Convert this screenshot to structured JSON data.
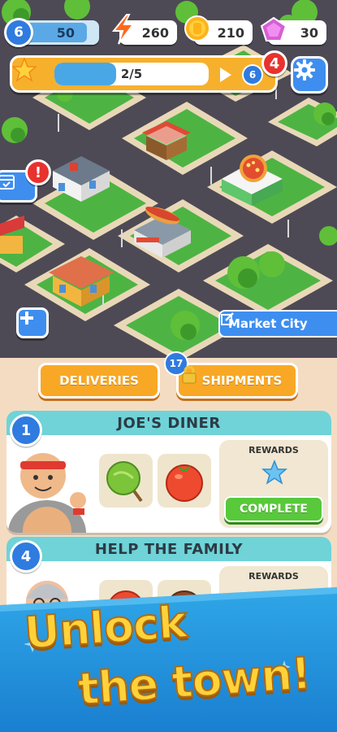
{
  "hud": {
    "level": "6",
    "level_xp": "50",
    "energy": "260",
    "coins": "210",
    "gems": "30"
  },
  "progress": {
    "text": "2/5",
    "fraction": 0.4,
    "next_level": "6",
    "alert_count": "4"
  },
  "map": {
    "market_button": "Market City"
  },
  "tabs": {
    "deliveries": "DELIVERIES",
    "shipments": "SHIPMENTS",
    "shipments_count": "17"
  },
  "orders": [
    {
      "number": "1",
      "title": "JOE'S DINER",
      "rewards_label": "REWARDS",
      "action": "COMPLETE"
    },
    {
      "number": "4",
      "title": "HELP THE FAMILY",
      "rewards_label": "REWARDS"
    }
  ],
  "banner": {
    "line1": "Unlock",
    "line2": "the town!"
  },
  "colors": {
    "accent_blue": "#3e8ef0",
    "accent_orange": "#f9a825",
    "complete_green": "#58c93a",
    "card_header": "#6fd3d8",
    "alert_red": "#e8322e"
  }
}
